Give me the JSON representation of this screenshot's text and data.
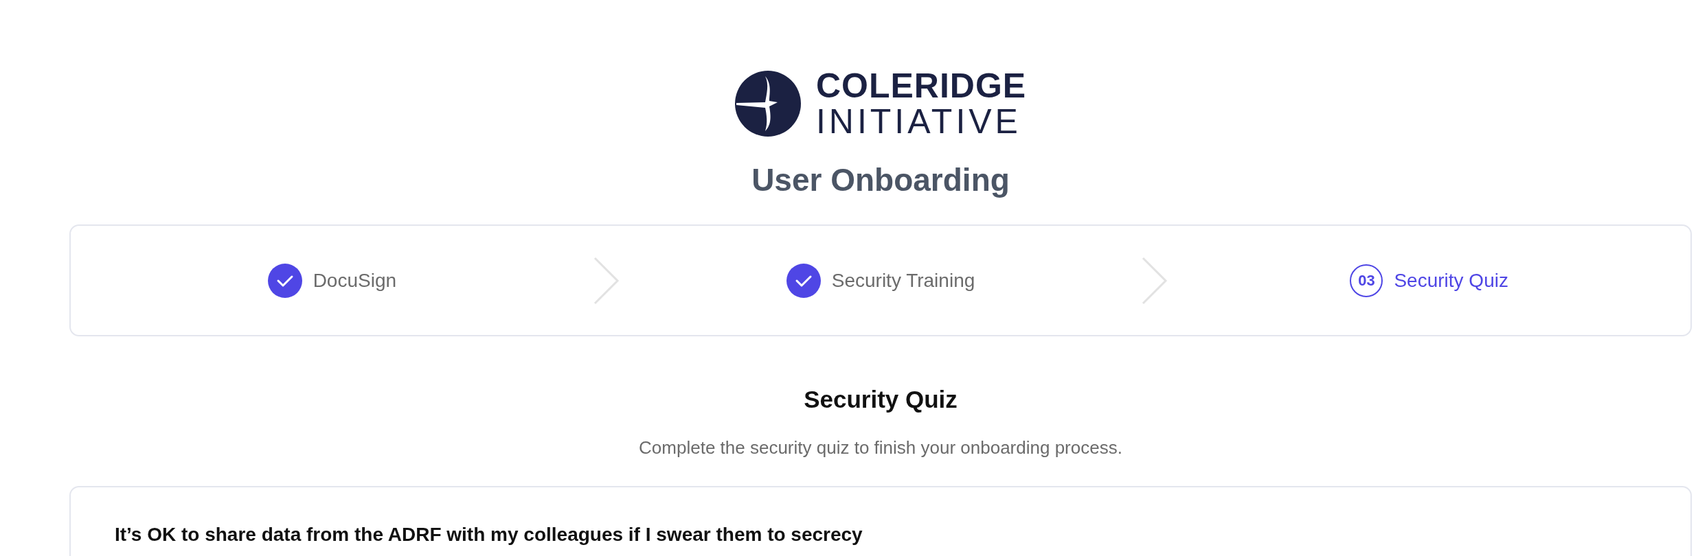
{
  "logo": {
    "line_1": "COLERIDGE",
    "line_2": "INITIATIVE"
  },
  "title": "User Onboarding",
  "steps": [
    {
      "label": "DocuSign",
      "completed": true,
      "selected": false
    },
    {
      "label": "Security Training",
      "completed": true,
      "selected": false
    },
    {
      "label": "Security Quiz",
      "completed": false,
      "selected": true,
      "number": "03"
    }
  ],
  "section": {
    "title": "Security Quiz",
    "subtitle": "Complete the security quiz to finish your onboarding process."
  },
  "quiz": {
    "question": "It’s OK to share data from the ADRF with my colleagues if I swear them to secrecy"
  }
}
